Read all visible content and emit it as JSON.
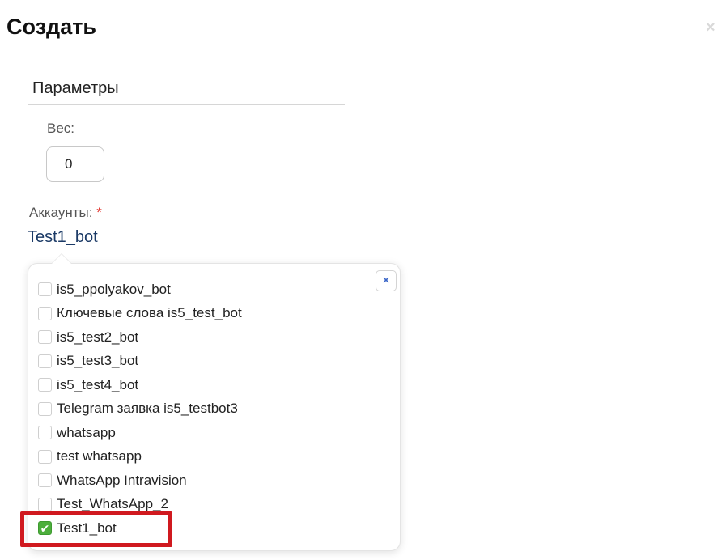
{
  "dialog": {
    "title": "Создать",
    "close_symbol": "×"
  },
  "params": {
    "section_title": "Параметры",
    "weight_label": "Вес:",
    "weight_value": "0"
  },
  "accounts": {
    "label": "Аккаунты:",
    "required_mark": "*",
    "selected_value": "Test1_bot",
    "close_symbol": "×",
    "check_symbol": "✔",
    "options": [
      {
        "label": "is5_ppolyakov_bot",
        "checked": false
      },
      {
        "label": "Ключевые слова is5_test_bot",
        "checked": false
      },
      {
        "label": "is5_test2_bot",
        "checked": false
      },
      {
        "label": "is5_test3_bot",
        "checked": false
      },
      {
        "label": "is5_test4_bot",
        "checked": false
      },
      {
        "label": "Telegram заявка is5_testbot3",
        "checked": false
      },
      {
        "label": "whatsapp",
        "checked": false
      },
      {
        "label": "test whatsapp",
        "checked": false
      },
      {
        "label": "WhatsApp Intravision",
        "checked": false
      },
      {
        "label": "Test_WhatsApp_2",
        "checked": false
      },
      {
        "label": "Test1_bot",
        "checked": true
      }
    ]
  },
  "colors": {
    "check_green": "#4cae3c",
    "highlight_red": "#d0191f",
    "link_blue": "#1b3a66",
    "required_red": "#e0332c"
  }
}
